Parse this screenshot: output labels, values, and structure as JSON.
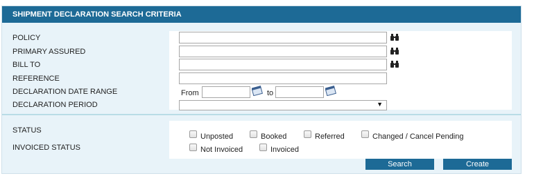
{
  "header": {
    "title": "SHIPMENT DECLARATION SEARCH CRITERIA"
  },
  "fields": {
    "policy_label": "POLICY",
    "primary_assured_label": "PRIMARY ASSURED",
    "bill_to_label": "BILL TO",
    "reference_label": "REFERENCE",
    "date_range_label": "DECLARATION DATE RANGE",
    "period_label": "DECLARATION PERIOD",
    "from_label": "From",
    "to_label": "to",
    "policy_value": "",
    "primary_assured_value": "",
    "bill_to_value": "",
    "reference_value": "",
    "from_value": "",
    "to_value": "",
    "period_value": ""
  },
  "status": {
    "status_label": "STATUS",
    "invoiced_label": "INVOICED STATUS",
    "options": [
      "Unposted",
      "Booked",
      "Referred",
      "Changed / Cancel Pending"
    ],
    "invoiced_options": [
      "Not Invoiced",
      "Invoiced"
    ]
  },
  "buttons": {
    "search": "Search",
    "create": "Create"
  },
  "icons": {
    "lookup": "binoculars-icon",
    "calendar": "calendar-icon",
    "dropdown": "chevron-down-icon"
  },
  "colors": {
    "header": "#1d6a96",
    "button": "#1d6a96",
    "panel": "#e8f3f9"
  }
}
